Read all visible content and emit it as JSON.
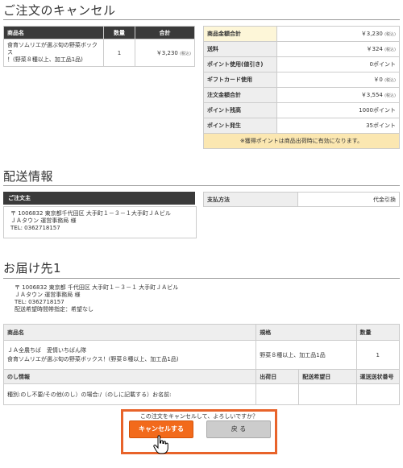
{
  "page_title": "ご注文のキャンセル",
  "order": {
    "headers": [
      "商品名",
      "数量",
      "合計"
    ],
    "item": {
      "name_line1": "食育ソムリエが選ぶ旬の野菜ボックス",
      "name_line2": "！(野菜８種以上、加工品1品)",
      "qty": "1",
      "total": "￥3,230",
      "tax_note": "(税込)"
    }
  },
  "summary": {
    "rows": [
      {
        "label": "商品金額合計",
        "value": "￥3,230",
        "tax": "(税込)"
      },
      {
        "label": "送料",
        "value": "￥324",
        "tax": "(税込)"
      },
      {
        "label": "ポイント使用(値引き)",
        "value": "0ポイント",
        "tax": ""
      },
      {
        "label": "ギフトカード使用",
        "value": "￥0",
        "tax": "(税込)"
      },
      {
        "label": "注文金額合計",
        "value": "￥3,554",
        "tax": "(税込)"
      },
      {
        "label": "ポイント残高",
        "value": "1000ポイント",
        "tax": ""
      },
      {
        "label": "ポイント発生",
        "value": "35ポイント",
        "tax": ""
      }
    ],
    "note": "※獲得ポイントは商品出荷時に有効になります。"
  },
  "shipping": {
    "title": "配送情報",
    "orderer_header": "ご注文主",
    "orderer": [
      "〒 1006832 東京都千代田区 大手町１－３－１大手町ＪＡビル",
      "ＪＡタウン 運営事務局 様",
      "TEL: 0362718157"
    ],
    "payment_label": "支払方法",
    "payment_value": "代金引換"
  },
  "delivery": {
    "title": "お届け先1",
    "address": [
      "〒 1006832 東京都 千代田区 大手町１－３－１ 大手町ＪＡビル",
      "ＪＡタウン 運営事務局 様",
      "TEL: 0362718157",
      "配送希望時間帯指定：希望なし"
    ],
    "headers": [
      "商品名",
      "規格",
      "数量"
    ],
    "item": {
      "line1": "ＪＡ全農ちば　愛情いちばん隊",
      "line2": "食育ソムリエが選ぶ旬の野菜ボックス！(野菜８種以上、加工品1品)",
      "spec": "野菜８種以上、加工品1品",
      "qty": "1"
    },
    "sub_headers": [
      "のし情報",
      "出荷日",
      "配送希望日",
      "運送送状番号"
    ],
    "noshi": "種別:のし不要/その他(のし）の場合:/（のしに記載する）お名前:"
  },
  "confirm": {
    "question": "この注文をキャンセルして、よろしいですか？",
    "cancel_label": "キャンセルする",
    "back_label": "戻 る"
  },
  "colors": {
    "accent": "#f26a1b",
    "highlight_border": "#e8632a",
    "dark_header": "#3a3a3a",
    "note_bg": "#fbe7b1"
  }
}
